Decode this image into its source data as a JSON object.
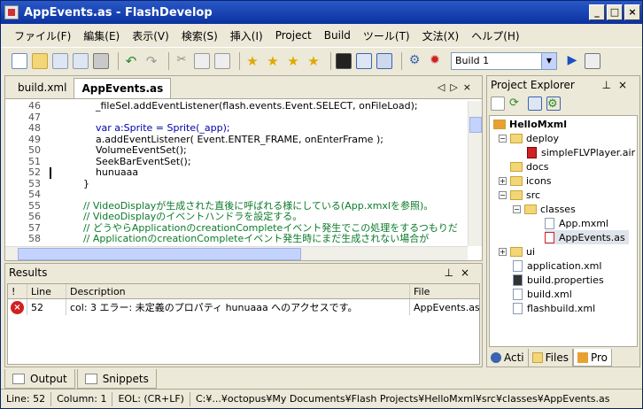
{
  "window": {
    "title": "AppEvents.as - FlashDevelop"
  },
  "menu": [
    "ファイル(F)",
    "編集(E)",
    "表示(V)",
    "検索(S)",
    "挿入(I)",
    "Project",
    "Build",
    "ツール(T)",
    "文法(X)",
    "ヘルプ(H)"
  ],
  "toolbar": {
    "build_config": "Build 1"
  },
  "editor": {
    "tabs": [
      "build.xml",
      "AppEvents.as"
    ],
    "active_tab": "AppEvents.as",
    "lines": [
      {
        "n": "46",
        "t": "            _fileSel.addEventListener(flash.events.Event.SELECT, onFileLoad);"
      },
      {
        "n": "47",
        "t": ""
      },
      {
        "n": "48",
        "t": "            var a:Sprite = Sprite(_app);"
      },
      {
        "n": "49",
        "t": "            a.addEventListener( Event.ENTER_FRAME, onEnterFrame );"
      },
      {
        "n": "50",
        "t": "            VolumeEventSet();"
      },
      {
        "n": "51",
        "t": "            SeekBarEventSet();"
      },
      {
        "n": "52",
        "t": "            hunuaaa"
      },
      {
        "n": "53",
        "t": "        }"
      },
      {
        "n": "54",
        "t": ""
      },
      {
        "n": "55",
        "t": "        // VideoDisplayが生成された直後に呼ばれる様にしている(App.xmxlを参照)。"
      },
      {
        "n": "56",
        "t": "        // VideoDisplayのイベントハンドラを設定する。"
      },
      {
        "n": "57",
        "t": "        // どうやらApplicationのcreationCompleteイベント発生でこの処理をするつもりだ"
      },
      {
        "n": "58",
        "t": "        // ApplicationのcreationCompleteイベント発生時にまだ生成されない場合が"
      }
    ]
  },
  "results": {
    "title": "Results",
    "columns": [
      "!",
      "Line",
      "Description",
      "File"
    ],
    "rows": [
      {
        "line": "52",
        "description": "col: 3 エラー: 未定義のプロパティ hunuaaa へのアクセスです。",
        "file": "AppEvents.as"
      }
    ]
  },
  "bottom_tabs": [
    "Output",
    "Snippets"
  ],
  "project_explorer": {
    "title": "Project Explorer",
    "tree": [
      {
        "label": "HelloMxml",
        "level": 0,
        "kind": "project"
      },
      {
        "label": "deploy",
        "level": 1,
        "kind": "folder-open"
      },
      {
        "label": "simpleFLVPlayer.air",
        "level": 2,
        "kind": "file"
      },
      {
        "label": "docs",
        "level": 1,
        "kind": "folder"
      },
      {
        "label": "icons",
        "level": 1,
        "kind": "folder-collapsed"
      },
      {
        "label": "src",
        "level": 1,
        "kind": "folder-open"
      },
      {
        "label": "classes",
        "level": 2,
        "kind": "folder-open"
      },
      {
        "label": "App.mxml",
        "level": 3,
        "kind": "file"
      },
      {
        "label": "AppEvents.as",
        "level": 3,
        "kind": "file-selected"
      },
      {
        "label": "ui",
        "level": 1,
        "kind": "folder-collapsed"
      },
      {
        "label": "application.xml",
        "level": 1,
        "kind": "file"
      },
      {
        "label": "build.properties",
        "level": 1,
        "kind": "file"
      },
      {
        "label": "build.xml",
        "level": 1,
        "kind": "file"
      },
      {
        "label": "flashbuild.xml",
        "level": 1,
        "kind": "file"
      }
    ],
    "tabs": [
      "Acti",
      "Files",
      "Pro"
    ]
  },
  "status": {
    "line": "Line: 52",
    "column": "Column: 1",
    "eol": "EOL: (CR+LF)",
    "path": "C:¥...¥octopus¥My Documents¥Flash Projects¥HelloMxml¥src¥classes¥AppEvents.as"
  }
}
